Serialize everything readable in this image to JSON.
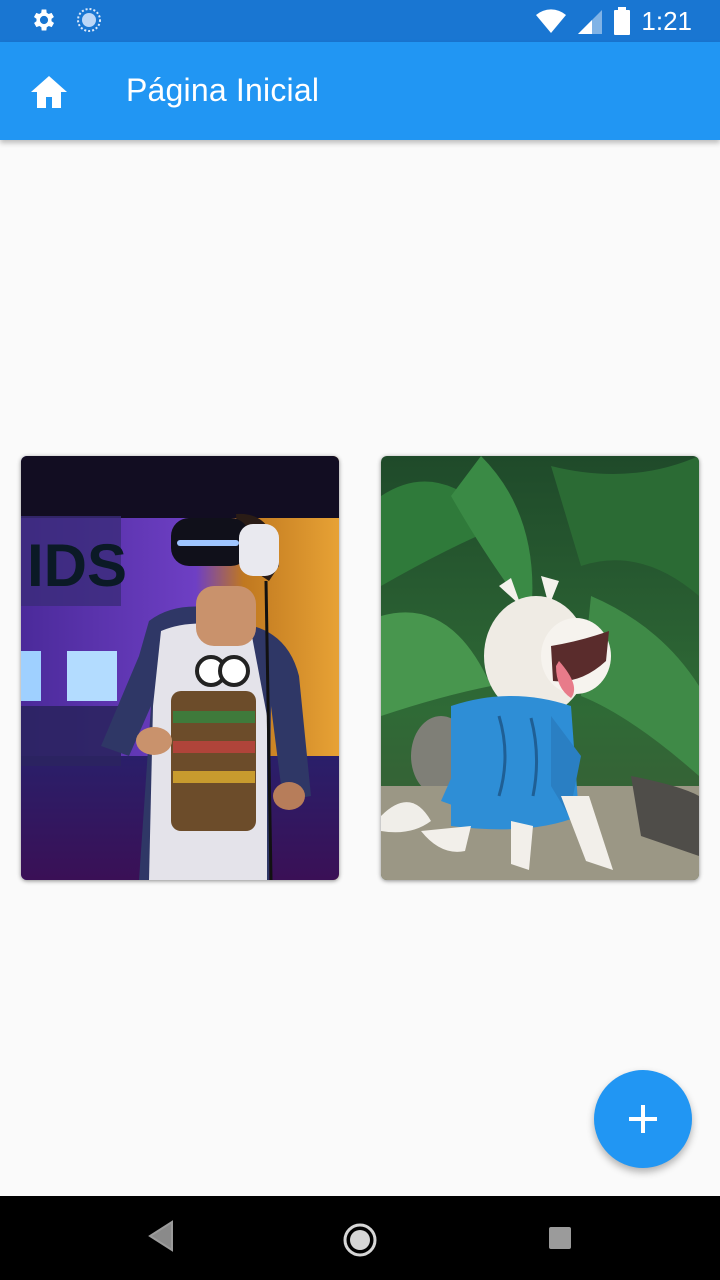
{
  "status_bar": {
    "time": "1:21",
    "icons": [
      "settings-icon",
      "sync-icon",
      "wifi-icon",
      "signal-icon",
      "battery-icon"
    ]
  },
  "app_bar": {
    "title": "Página Inicial",
    "icon": "home-icon",
    "background": "#2196f3"
  },
  "gallery": {
    "items": [
      {
        "subject": "photo-vr-headset",
        "alt": ""
      },
      {
        "subject": "photo-dog",
        "alt": ""
      }
    ]
  },
  "fab": {
    "icon": "plus-icon",
    "color": "#2196f3"
  },
  "nav_bar": {
    "buttons": [
      "back-icon",
      "home-circle-icon",
      "recents-icon"
    ]
  }
}
